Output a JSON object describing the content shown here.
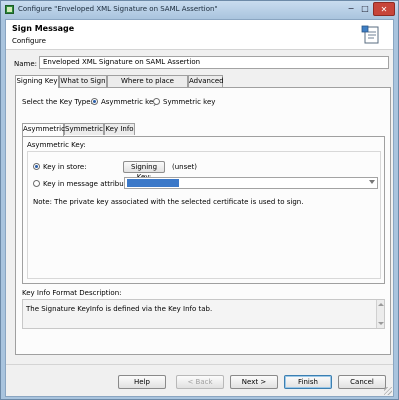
{
  "window": {
    "title": "Configure \"Enveloped XML Signature on SAML Assertion\"",
    "min_glyph": "−",
    "max_glyph": "□",
    "close_glyph": "✕"
  },
  "header": {
    "title": "Sign Message",
    "subtitle": "Configure"
  },
  "name_field": {
    "label": "Name:",
    "value": "Enveloped XML Signature on SAML Assertion"
  },
  "tabs": [
    {
      "label": "Signing Key",
      "active": true
    },
    {
      "label": "What to Sign",
      "active": false
    },
    {
      "label": "Where to place signature",
      "active": false
    },
    {
      "label": "Advanced",
      "active": false
    }
  ],
  "key_type": {
    "label": "Select the Key Type:",
    "options": [
      {
        "label": "Asymmetric key",
        "selected": true
      },
      {
        "label": "Symmetric key",
        "selected": false
      }
    ]
  },
  "sub_tabs": [
    {
      "label": "Asymmetric",
      "active": true
    },
    {
      "label": "Symmetric",
      "active": false
    },
    {
      "label": "Key Info",
      "active": false
    }
  ],
  "asymmetric": {
    "group_label": "Asymmetric Key:",
    "key_in_store": {
      "label": "Key in store:",
      "selected": true,
      "button": "Signing Key:",
      "value": "(unset)"
    },
    "key_in_attribute": {
      "label": "Key in message attribute:",
      "selected": false,
      "value": ""
    },
    "note": "Note: The private key associated with the selected certificate is used to sign."
  },
  "key_info_format": {
    "label": "Key Info Format Description:",
    "text": "The Signature KeyInfo is defined via the Key Info tab."
  },
  "footer": {
    "help": "Help",
    "back": "< Back",
    "next": "Next >",
    "finish": "Finish",
    "cancel": "Cancel"
  },
  "colors": {
    "window_frame": "#a9c4de",
    "selection": "#3b78c8",
    "close_button": "#c7453a"
  }
}
